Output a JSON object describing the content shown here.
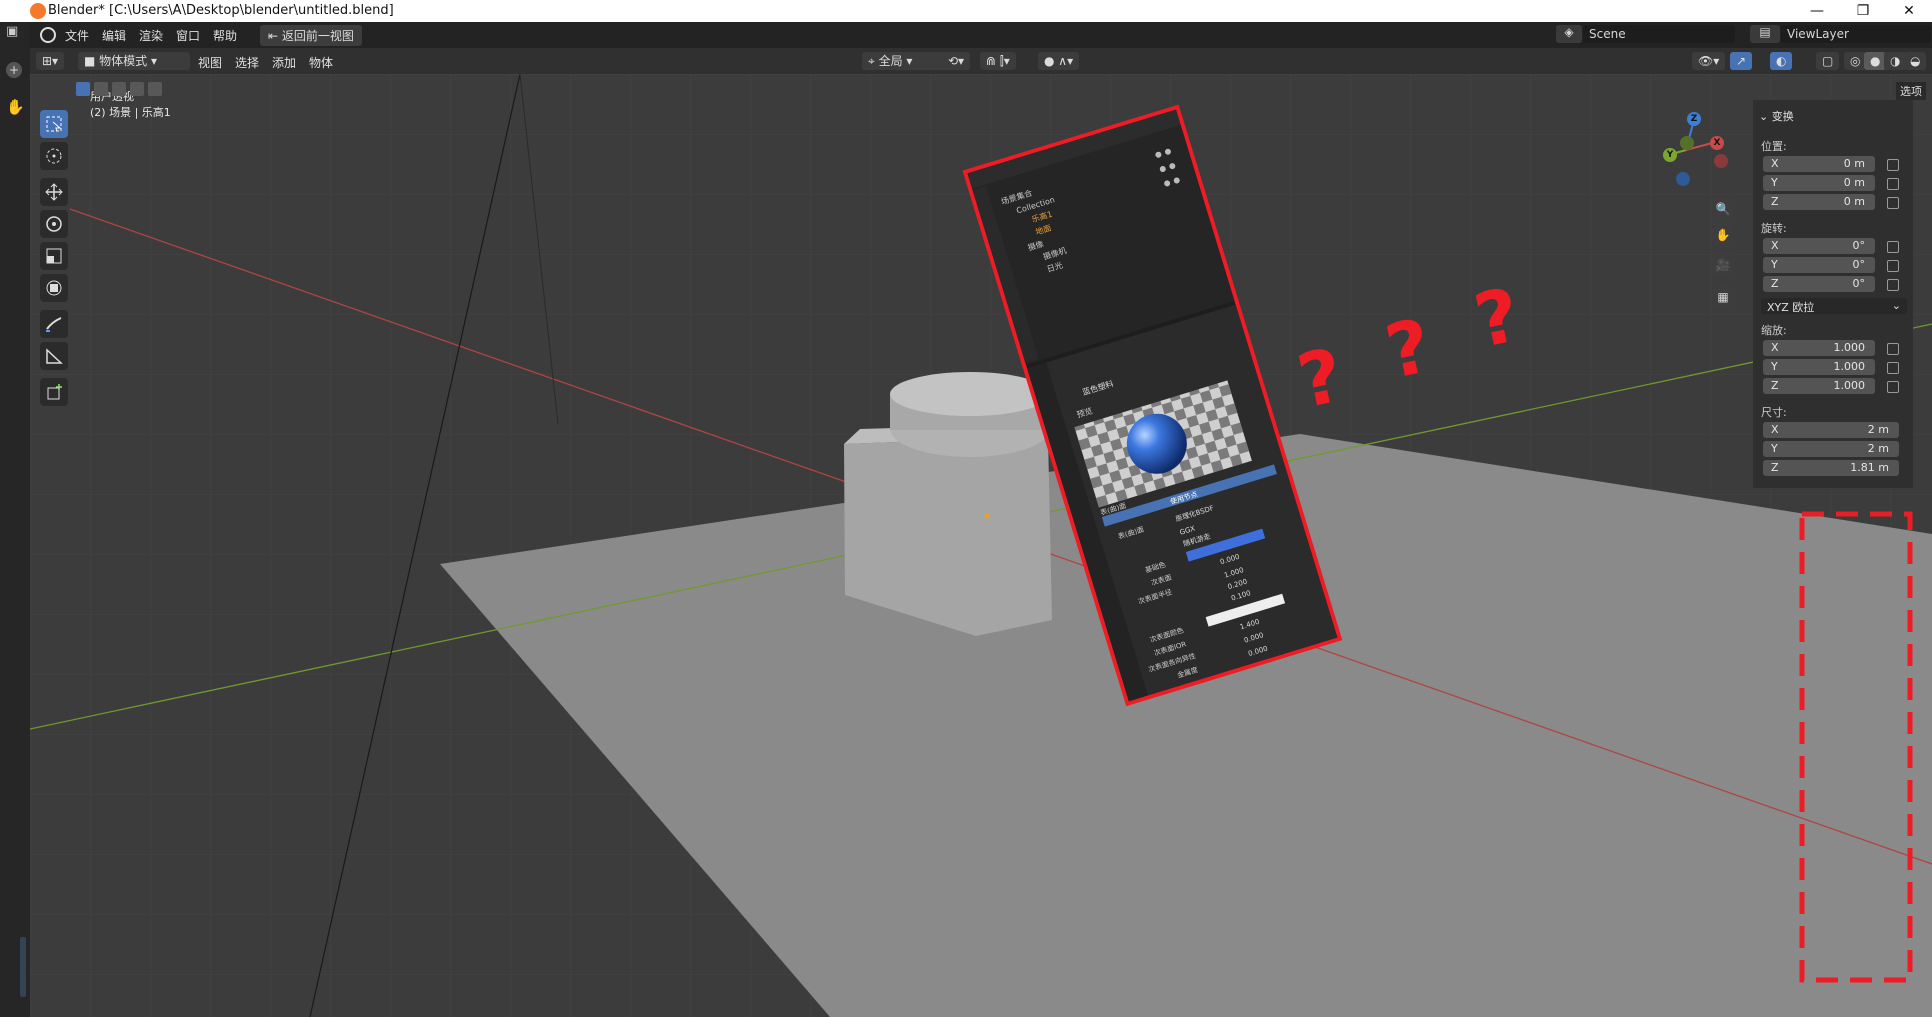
{
  "window": {
    "title": "Blender* [C:\\Users\\A\\Desktop\\blender\\untitled.blend]",
    "minimize": "—",
    "restore": "❐",
    "close": "✕"
  },
  "menu": {
    "file": "文件",
    "edit": "编辑",
    "render": "渲染",
    "window": "窗口",
    "help": "帮助",
    "back": "返回前一视图"
  },
  "scene": {
    "name": "Scene",
    "view_layer": "ViewLayer"
  },
  "header": {
    "mode": "物体模式",
    "view": "视图",
    "select": "选择",
    "add": "添加",
    "object": "物体",
    "transform_orientation": "全局",
    "options_tab": "选项"
  },
  "viewport": {
    "view_name": "用户透视",
    "info": "(2) 场景 | 乐高1"
  },
  "sidebar": {
    "section": "变换",
    "location_label": "位置:",
    "location": [
      {
        "axis": "X",
        "value": "0 m"
      },
      {
        "axis": "Y",
        "value": "0 m"
      },
      {
        "axis": "Z",
        "value": "0 m"
      }
    ],
    "rotation_label": "旋转:",
    "rotation": [
      {
        "axis": "X",
        "value": "0°"
      },
      {
        "axis": "Y",
        "value": "0°"
      },
      {
        "axis": "Z",
        "value": "0°"
      }
    ],
    "rotation_mode": "XYZ 欧拉",
    "scale_label": "缩放:",
    "scale": [
      {
        "axis": "X",
        "value": "1.000"
      },
      {
        "axis": "Y",
        "value": "1.000"
      },
      {
        "axis": "Z",
        "value": "1.000"
      }
    ],
    "dimensions_label": "尺寸:",
    "dimensions": [
      {
        "axis": "X",
        "value": "2 m"
      },
      {
        "axis": "Y",
        "value": "2 m"
      },
      {
        "axis": "Z",
        "value": "1.81 m"
      }
    ]
  },
  "gizmo": {
    "x": "X",
    "y": "Y",
    "z": "Z"
  },
  "floating_panel": {
    "outliner": [
      "场景集合",
      "Collection",
      "乐高1",
      "地面",
      "摄像",
      "摄像机",
      "日光"
    ],
    "material": "蓝色塑料",
    "preview": "预览",
    "surface": "表(曲)面",
    "use_nodes": "使用节点",
    "shader_label": "表(曲)面",
    "shader": "原理化BSDF",
    "distribution": "GGX",
    "subsurface_method": "随机游走",
    "base_color": "基础色",
    "subsurface": "次表面",
    "subsurface_radius": "次表面半径",
    "subsurface_color": "次表面颜色",
    "subsurface_ior": "次表面IOR",
    "subsurface_aniso": "次表面各向异性",
    "metallic": "金属度",
    "values": [
      "0.000",
      "1.000",
      "0.200",
      "0.100",
      "1.400",
      "0.000",
      "0.000"
    ]
  },
  "annotation": {
    "marks": [
      "?",
      "?",
      "?"
    ]
  },
  "colors": {
    "accent": "#4772b3",
    "highlight_red": "#ee1c24",
    "x_axis": "#c94a4a",
    "y_axis": "#7ca72f",
    "z_axis": "#3e7fd6"
  }
}
